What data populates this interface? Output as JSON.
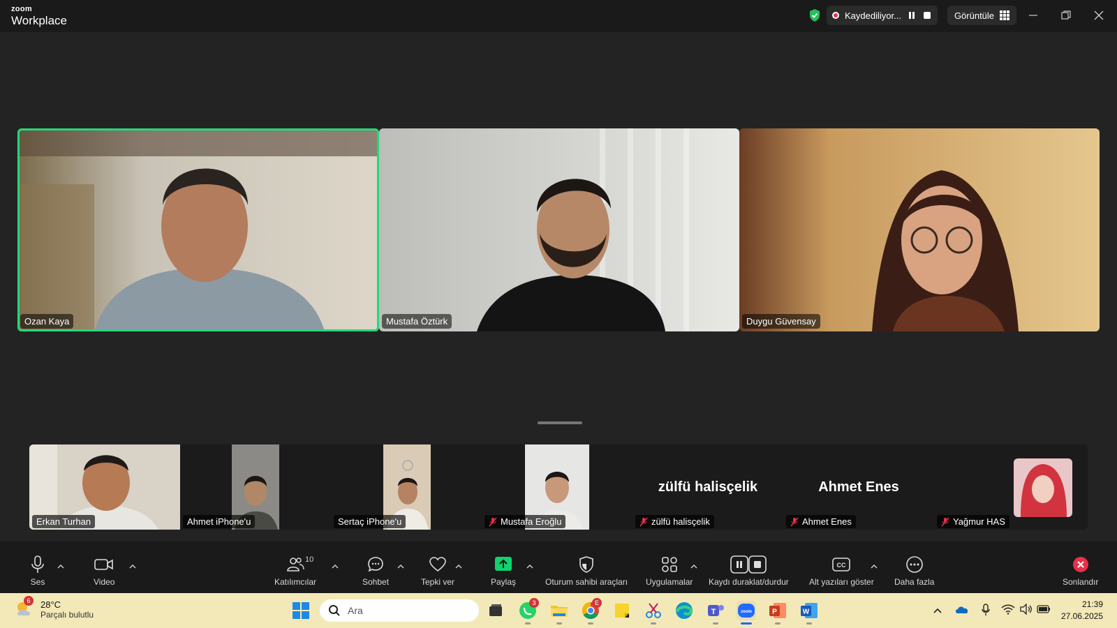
{
  "app": {
    "brand_small": "zoom",
    "brand_big": "Workplace"
  },
  "recording": {
    "label": "Kaydediliyor..."
  },
  "view": {
    "label": "Görüntüle"
  },
  "main_tiles": [
    {
      "name": "Ozan Kaya",
      "active": true
    },
    {
      "name": "Mustafa Öztürk",
      "active": false
    },
    {
      "name": "Duygu Güvensay",
      "active": false
    }
  ],
  "gallery": [
    {
      "name": "Erkan Turhan",
      "muted": false
    },
    {
      "name": "Ahmet iPhone'u",
      "muted": false
    },
    {
      "name": "Sertaç iPhone'u",
      "muted": false
    },
    {
      "name": "Mustafa Eroğlu",
      "muted": true
    },
    {
      "name": "zülfü halisçelik",
      "muted": true,
      "display_name": "zülfü halisçelik"
    },
    {
      "name": "Ahmet Enes",
      "muted": true,
      "display_name": "Ahmet Enes"
    },
    {
      "name": "Yağmur HAS",
      "muted": true
    }
  ],
  "toolbar": {
    "audio": "Ses",
    "video": "Video",
    "participants": "Katılımcılar",
    "participants_count": "10",
    "chat": "Sohbet",
    "react": "Tepki ver",
    "share": "Paylaş",
    "host_tools": "Oturum sahibi araçları",
    "apps": "Uygulamalar",
    "pause_stop_recording": "Kaydı duraklat/durdur",
    "captions": "Alt yazıları göster",
    "more": "Daha fazla",
    "end": "Sonlandır"
  },
  "taskbar": {
    "weather_temp": "28°C",
    "weather_desc": "Parçalı bulutlu",
    "weather_badge": "6",
    "search_placeholder": "Ara",
    "whatsapp_badge": "3",
    "chrome_badge": "E",
    "time": "21:39",
    "date": "27.06.2025"
  },
  "colors": {
    "active_speaker": "#23d97a",
    "share_green": "#0fd36e",
    "end_red": "#e8304a",
    "taskbar_bg": "#f3e9b8"
  }
}
